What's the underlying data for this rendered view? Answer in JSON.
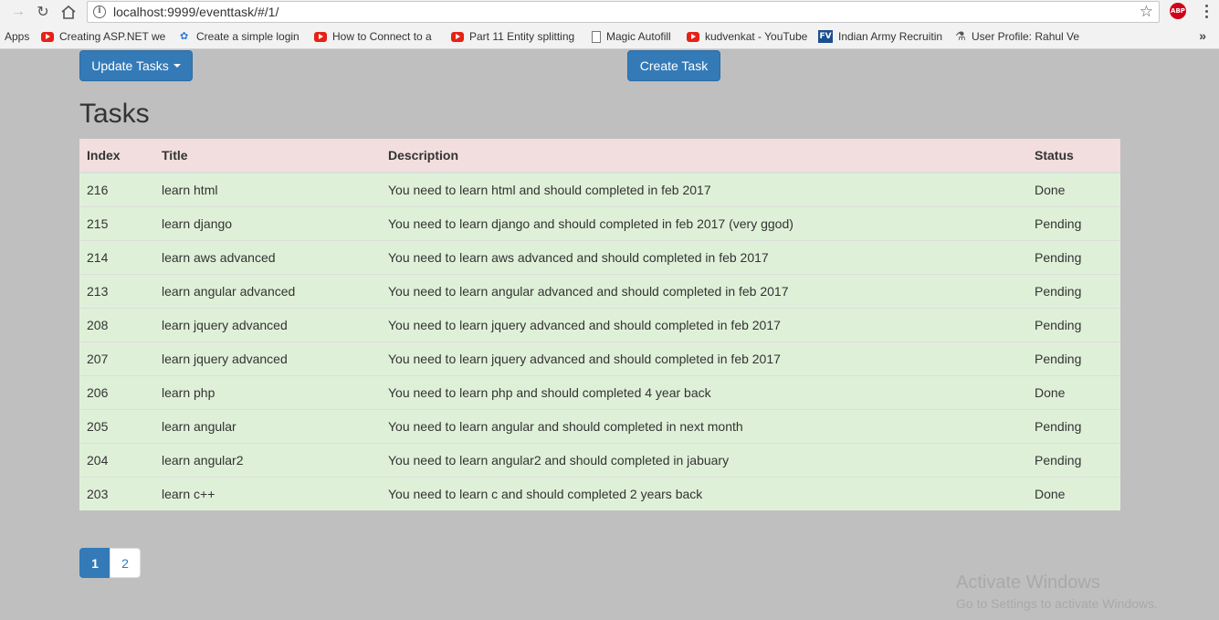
{
  "browser": {
    "url": "localhost:9999/eventtask/#/1/",
    "abp_label": "ABP",
    "bookmarks": [
      {
        "label": "Apps",
        "icon": "apps-icon"
      },
      {
        "label": "Creating ASP.NET wel",
        "icon": "youtube-icon"
      },
      {
        "label": "Create a simple login",
        "icon": "swirl-icon"
      },
      {
        "label": "How to Connect to a",
        "icon": "youtube-icon"
      },
      {
        "label": "Part 11 Entity splitting",
        "icon": "youtube-icon"
      },
      {
        "label": "Magic Autofill",
        "icon": "document-icon"
      },
      {
        "label": "kudvenkat - YouTube",
        "icon": "youtube-icon"
      },
      {
        "label": "Indian Army Recruitin",
        "icon": "fv-icon"
      },
      {
        "label": "User Profile: Rahul Ve",
        "icon": "stackoverflow-icon"
      }
    ],
    "fv_text": "FV",
    "more_label": "»"
  },
  "toolbar": {
    "update_label": "Update Tasks",
    "create_label": "Create Task"
  },
  "page": {
    "heading": "Tasks"
  },
  "table": {
    "headers": [
      "Index",
      "Title",
      "Description",
      "Status"
    ],
    "rows": [
      [
        "216",
        "learn html",
        "You need to learn html and should completed in feb 2017",
        "Done"
      ],
      [
        "215",
        "learn django",
        "You need to learn django and should completed in feb 2017 (very ggod)",
        "Pending"
      ],
      [
        "214",
        "learn aws advanced",
        "You need to learn aws advanced and should completed in feb 2017",
        "Pending"
      ],
      [
        "213",
        "learn angular advanced",
        "You need to learn angular advanced and should completed in feb 2017",
        "Pending"
      ],
      [
        "208",
        "learn jquery advanced",
        "You need to learn jquery advanced and should completed in feb 2017",
        "Pending"
      ],
      [
        "207",
        "learn jquery advanced",
        "You need to learn jquery advanced and should completed in feb 2017",
        "Pending"
      ],
      [
        "206",
        "learn php",
        "You need to learn php and should completed 4 year back",
        "Done"
      ],
      [
        "205",
        "learn angular",
        "You need to learn angular and should completed in next month",
        "Pending"
      ],
      [
        "204",
        "learn angular2",
        "You need to learn angular2 and should completed in jabuary",
        "Pending"
      ],
      [
        "203",
        "learn c++",
        "You need to learn c and should completed 2 years back",
        "Done"
      ]
    ]
  },
  "pagination": {
    "pages": [
      "1",
      "2"
    ],
    "active": "1"
  },
  "watermark": {
    "title": "Activate Windows",
    "subtitle": "Go to Settings to activate Windows."
  },
  "colors": {
    "primary": "#337ab7",
    "header_row": "#f2dede",
    "body_row": "#dff0d8",
    "background": "#bfbfbf"
  }
}
